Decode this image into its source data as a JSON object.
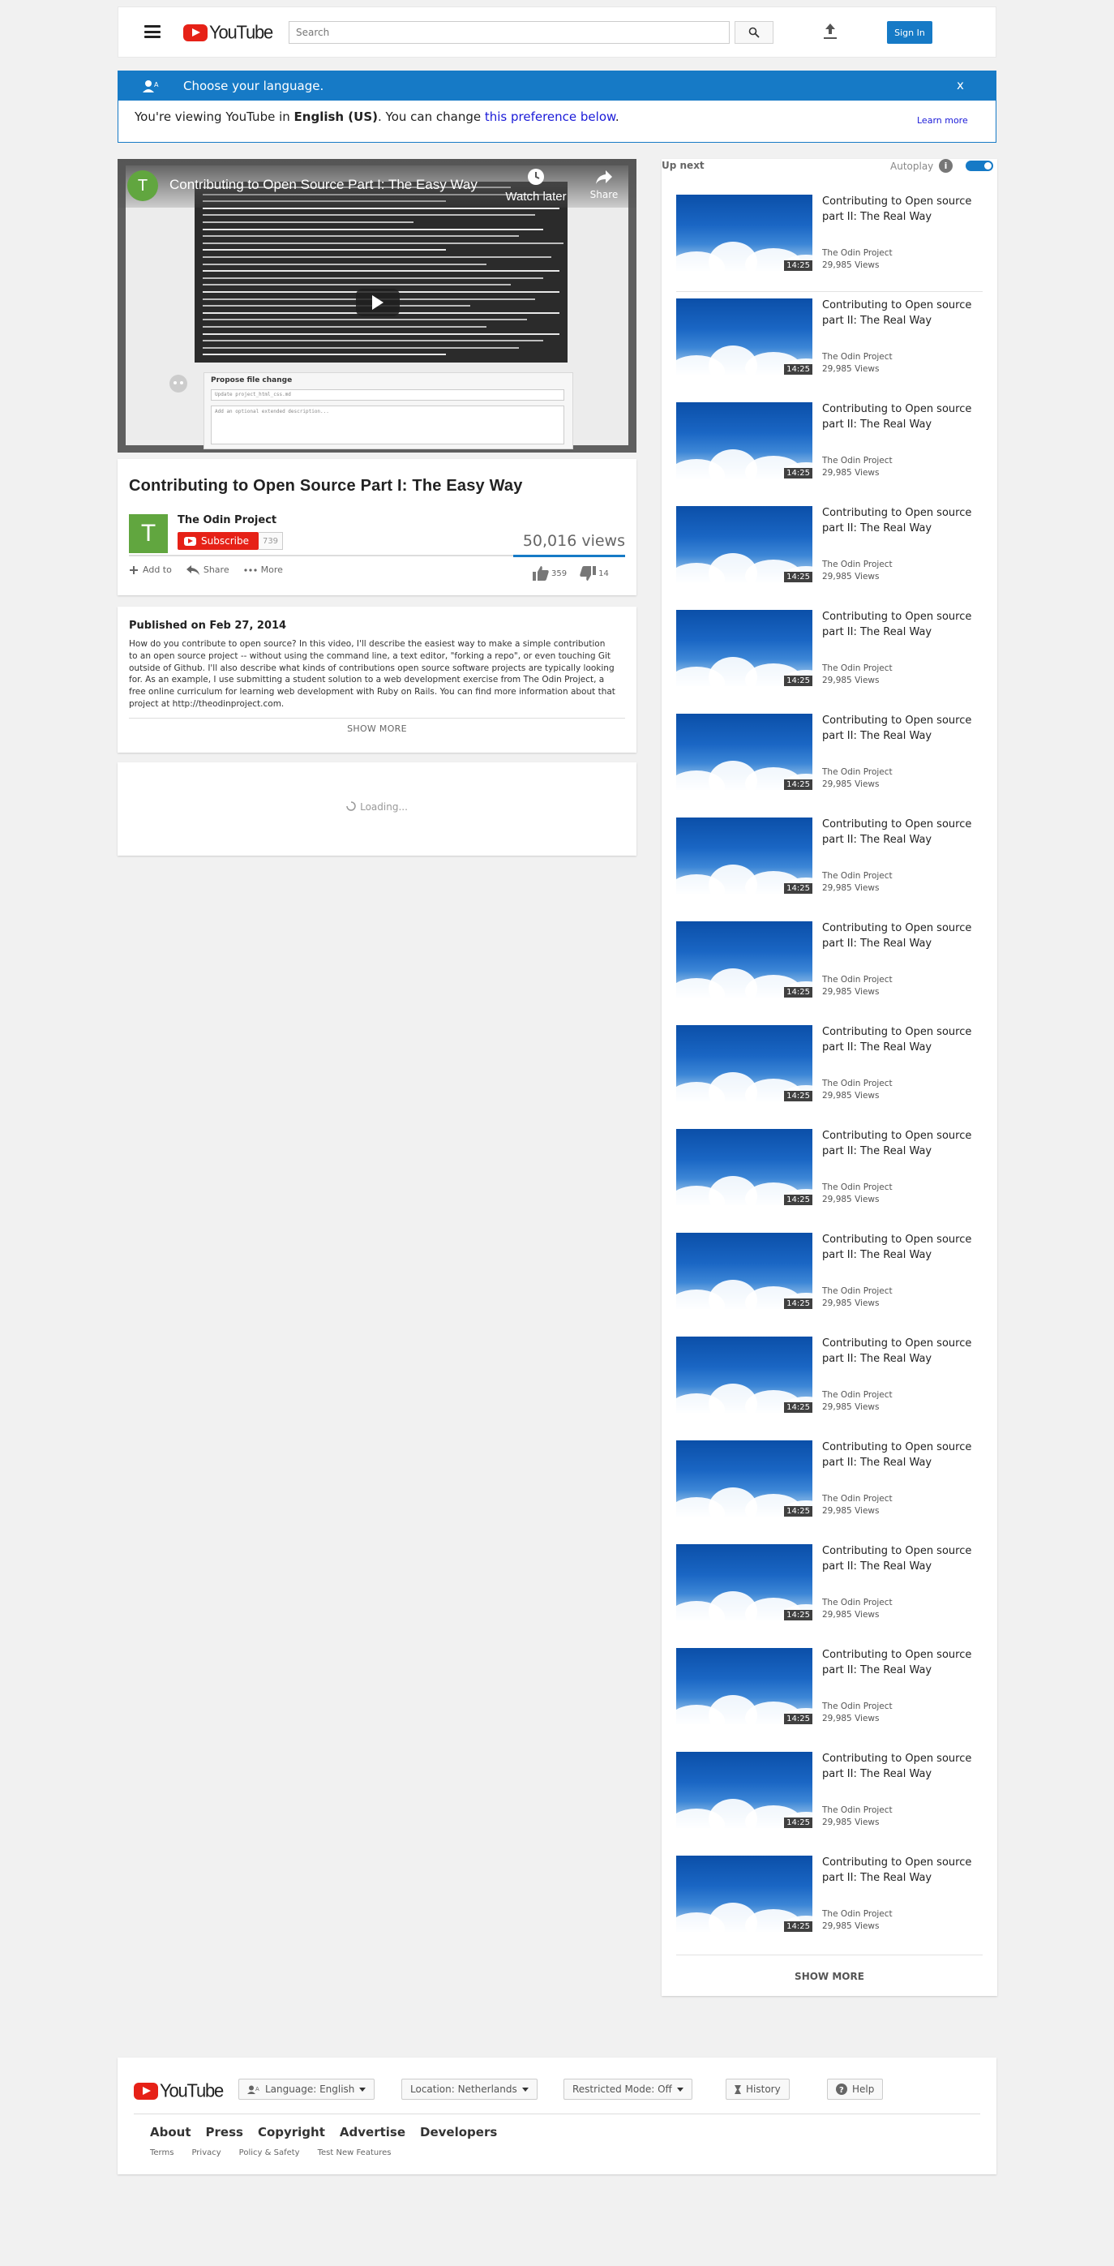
{
  "header": {
    "logo_text": "YouTube",
    "search_placeholder": "Search",
    "signin_label": "Sign In"
  },
  "language_banner": {
    "title": "Choose your language.",
    "close": "x",
    "text_prefix": "You're viewing YouTube in ",
    "language": "English (US)",
    "text_middle": ". You can change ",
    "link_text": "this preference below",
    "text_suffix": ".",
    "learn_more": "Learn more"
  },
  "player": {
    "channel_initial": "T",
    "title": "Contributing to Open Source Part I: The Easy Way",
    "watch_later": "Watch later",
    "share": "Share",
    "propose_title": "Propose file change",
    "propose_input": "Update project_html_css.md",
    "propose_area": "Add an optional extended description..."
  },
  "video": {
    "title": "Contributing to Open Source Part I: The Easy Way",
    "owner_initial": "T",
    "owner": "The Odin Project",
    "subscribe": "Subscribe",
    "subscriber_count": "739",
    "views": "50,016 views",
    "like_ratio": 0.962,
    "add_to": "Add to",
    "share": "Share",
    "more": "More",
    "likes": "359",
    "dislikes": "14"
  },
  "description": {
    "published": "Published on Feb 27, 2014",
    "text": "How do you contribute to open source? In this video, I'll describe the easiest way to make a simple contribution to an open source project -- without using the command line, a text editor, \"forking a repo\", or even touching Git outside of Github. I'll also describe what kinds of contributions open source software projects are typically looking for. As an example, I use submitting a student solution to a web development exercise from The Odin Project, a free online curriculum for learning web development with Ruby on Rails. You can find more information about that project at http://theodinproject.com.",
    "show_more": "SHOW MORE"
  },
  "comments": {
    "loading": "Loading..."
  },
  "sidebar": {
    "up_next": "Up next",
    "autoplay": "Autoplay",
    "autoplay_on": true,
    "show_more": "SHOW MORE",
    "items": [
      {
        "title": "Contributing to Open source part II: The Real Way",
        "channel": "The Odin Project",
        "views": "29,985 Views",
        "duration": "14:25"
      },
      {
        "title": "Contributing to Open source part II: The Real Way",
        "channel": "The Odin Project",
        "views": "29,985 Views",
        "duration": "14:25"
      },
      {
        "title": "Contributing to Open source part II: The Real Way",
        "channel": "The Odin Project",
        "views": "29,985 Views",
        "duration": "14:25"
      },
      {
        "title": "Contributing to Open source part II: The Real Way",
        "channel": "The Odin Project",
        "views": "29,985 Views",
        "duration": "14:25"
      },
      {
        "title": "Contributing to Open source part II: The Real Way",
        "channel": "The Odin Project",
        "views": "29,985 Views",
        "duration": "14:25"
      },
      {
        "title": "Contributing to Open source part II: The Real Way",
        "channel": "The Odin Project",
        "views": "29,985 Views",
        "duration": "14:25"
      },
      {
        "title": "Contributing to Open source part II: The Real Way",
        "channel": "The Odin Project",
        "views": "29,985 Views",
        "duration": "14:25"
      },
      {
        "title": "Contributing to Open source part II: The Real Way",
        "channel": "The Odin Project",
        "views": "29,985 Views",
        "duration": "14:25"
      },
      {
        "title": "Contributing to Open source part II: The Real Way",
        "channel": "The Odin Project",
        "views": "29,985 Views",
        "duration": "14:25"
      },
      {
        "title": "Contributing to Open source part II: The Real Way",
        "channel": "The Odin Project",
        "views": "29,985 Views",
        "duration": "14:25"
      },
      {
        "title": "Contributing to Open source part II: The Real Way",
        "channel": "The Odin Project",
        "views": "29,985 Views",
        "duration": "14:25"
      },
      {
        "title": "Contributing to Open source part II: The Real Way",
        "channel": "The Odin Project",
        "views": "29,985 Views",
        "duration": "14:25"
      },
      {
        "title": "Contributing to Open source part II: The Real Way",
        "channel": "The Odin Project",
        "views": "29,985 Views",
        "duration": "14:25"
      },
      {
        "title": "Contributing to Open source part II: The Real Way",
        "channel": "The Odin Project",
        "views": "29,985 Views",
        "duration": "14:25"
      },
      {
        "title": "Contributing to Open source part II: The Real Way",
        "channel": "The Odin Project",
        "views": "29,985 Views",
        "duration": "14:25"
      },
      {
        "title": "Contributing to Open source part II: The Real Way",
        "channel": "The Odin Project",
        "views": "29,985 Views",
        "duration": "14:25"
      },
      {
        "title": "Contributing to Open source part II: The Real Way",
        "channel": "The Odin Project",
        "views": "29,985 Views",
        "duration": "14:25"
      }
    ]
  },
  "footer": {
    "logo_text": "YouTube",
    "language": "Language: English",
    "location": "Location: Netherlands",
    "restricted": "Restricted Mode: Off",
    "history": "History",
    "help": "Help",
    "links": [
      "About",
      "Press",
      "Copyright",
      "Advertise",
      "Developers"
    ],
    "small_links": [
      "Terms",
      "Privacy",
      "Policy & Safety",
      "Test New Features"
    ]
  },
  "colors": {
    "brand_red": "#e62117",
    "accent_blue": "#167ac6",
    "channel_green": "#61a63f"
  }
}
